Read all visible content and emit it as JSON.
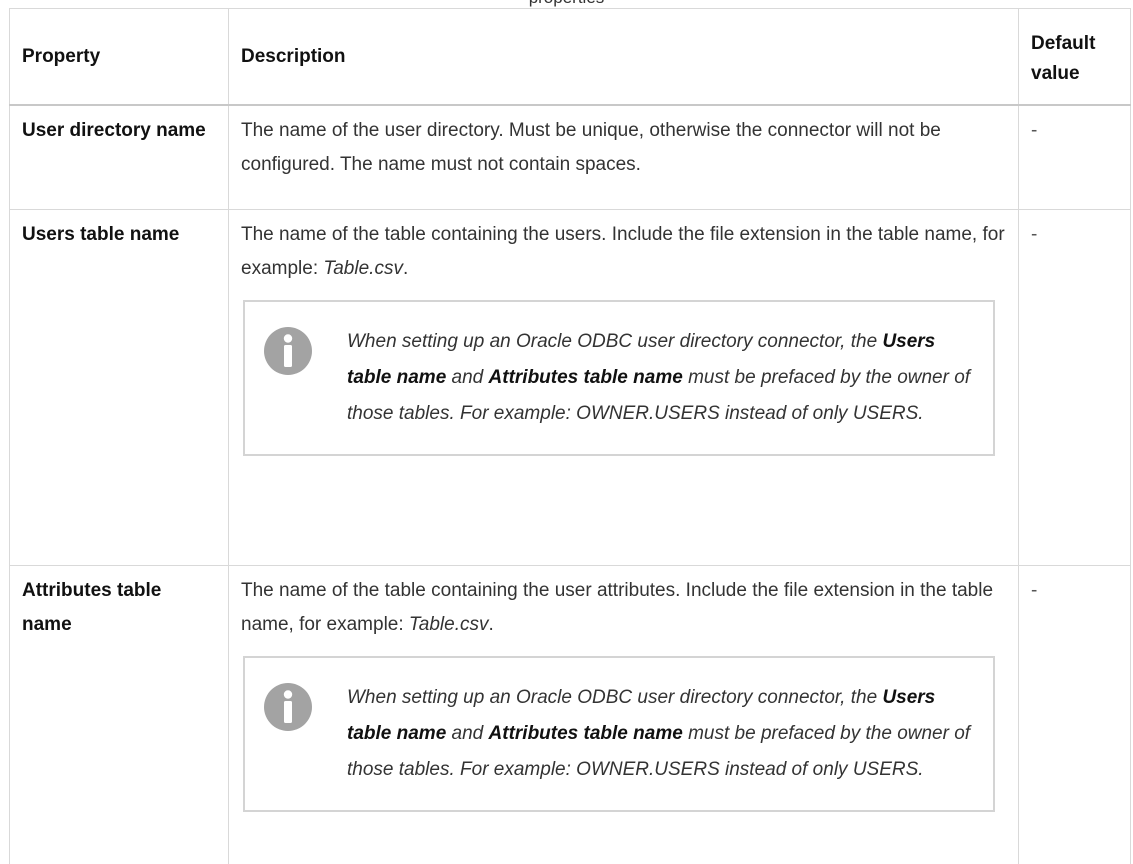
{
  "page_caption": "properties",
  "table": {
    "headers": {
      "property": "Property",
      "description": "Description",
      "default_value": "Default value"
    },
    "rows": [
      {
        "property": "User directory name",
        "description": "The name of the user directory. Must be unique, otherwise the connector will not be configured. The name must not contain spaces.",
        "default": "-"
      },
      {
        "property": "Users table name",
        "description_prefix": "The name of the table containing the users. Include the file extension in the table name, for example: ",
        "description_example": "Table.csv",
        "description_suffix": ".",
        "note": {
          "icon": "info-icon",
          "part1": "When setting up an Oracle ODBC user directory connector, the ",
          "bold1": "Users table name",
          "part2": " and ",
          "bold2": "Attributes table name",
          "part3": " must be prefaced by the owner of those tables. For example: OWNER.USERS instead of only USERS."
        },
        "default": "-"
      },
      {
        "property": "Attributes table name",
        "description_prefix": "The name of the table containing the user attributes. Include the file extension in the table name, for example: ",
        "description_example": "Table.csv",
        "description_suffix": ".",
        "note": {
          "icon": "info-icon",
          "part1": "When setting up an Oracle ODBC user directory connector, the ",
          "bold1": "Users table name",
          "part2": " and ",
          "bold2": "Attributes table name",
          "part3": " must be prefaced by the owner of those tables. For example: OWNER.USERS instead of only USERS."
        },
        "default": "-"
      }
    ]
  },
  "colors": {
    "border": "#d9d9d9",
    "note_border": "#d4d4d4",
    "info_icon": "#a3a3a3"
  }
}
